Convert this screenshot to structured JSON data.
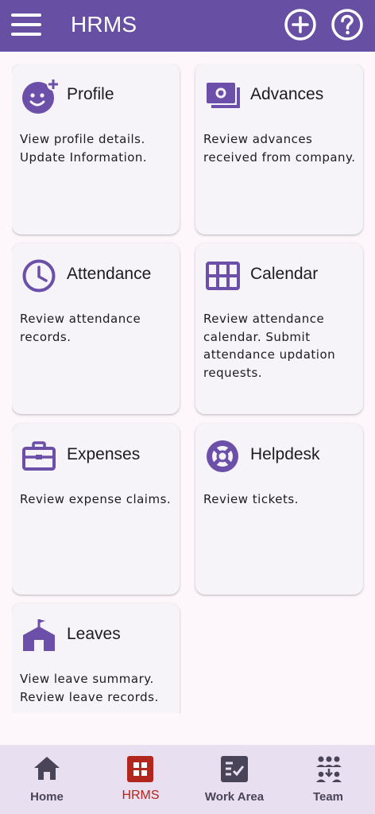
{
  "appbar": {
    "title": "HRMS",
    "menu_icon": "menu-icon",
    "actions": [
      {
        "icon": "add-circle-icon"
      },
      {
        "icon": "help-circle-icon"
      }
    ],
    "background": "#6750a4"
  },
  "cards": [
    {
      "title": "Profile",
      "icon": "face-add-icon",
      "desc": "View profile details. Update Information."
    },
    {
      "title": "Advances",
      "icon": "payments-icon",
      "desc": "Review advances received from company."
    },
    {
      "title": "Attendance",
      "icon": "clock-icon",
      "desc": "Review attendance records."
    },
    {
      "title": "Calendar",
      "icon": "calendar-grid-icon",
      "desc": "Review attendance calendar. Submit attendance updation requests."
    },
    {
      "title": "Expenses",
      "icon": "briefcase-icon",
      "desc": "Review expense claims."
    },
    {
      "title": "Helpdesk",
      "icon": "lifebuoy-icon",
      "desc": "Review tickets."
    },
    {
      "title": "Leaves",
      "icon": "house-icon",
      "desc": "View leave summary. Review leave records."
    }
  ],
  "nav": {
    "items": [
      {
        "label": "Home",
        "icon": "home-icon"
      },
      {
        "label": "HRMS",
        "icon": "apps-grid-icon",
        "active": true
      },
      {
        "label": "Work Area",
        "icon": "task-list-icon"
      },
      {
        "label": "Team",
        "icon": "team-icon"
      }
    ]
  },
  "colors": {
    "accent": "#6750a4",
    "icon": "#6b4fa8",
    "active": "#b3261e",
    "nav_bg": "#e8dff0"
  }
}
